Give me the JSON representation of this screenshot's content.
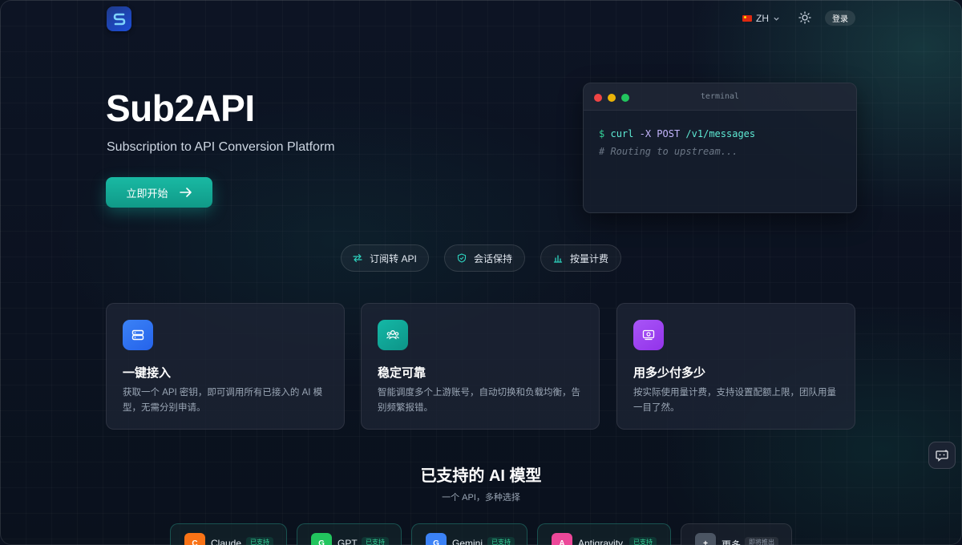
{
  "header": {
    "logo_icon": "sub2api-logo-icon",
    "language": "ZH",
    "theme_icon": "sun-icon",
    "login_label": "登录"
  },
  "hero": {
    "title": "Sub2API",
    "subtitle": "Subscription to API Conversion Platform",
    "cta_label": "立即开始"
  },
  "terminal": {
    "title": "terminal",
    "prompt": "$",
    "command": "curl",
    "flag": "-X POST",
    "path": "/v1/messages",
    "comment": "# Routing to upstream..."
  },
  "pills": [
    {
      "label": "订阅转 API",
      "icon": "swap-arrows-icon"
    },
    {
      "label": "会话保持",
      "icon": "shield-check-icon"
    },
    {
      "label": "按量计费",
      "icon": "bar-chart-icon"
    }
  ],
  "features": [
    {
      "title": "一键接入",
      "desc": "获取一个 API 密钥，即可调用所有已接入的 AI 模型，无需分别申请。",
      "icon": "server-icon",
      "color": "#3b82f6"
    },
    {
      "title": "稳定可靠",
      "desc": "智能调度多个上游账号，自动切换和负载均衡，告别频繁报错。",
      "icon": "users-icon",
      "color": "#14b8a6"
    },
    {
      "title": "用多少付多少",
      "desc": "按实际使用量计费，支持设置配额上限，团队用量一目了然。",
      "icon": "billing-icon",
      "color": "#a855f7"
    }
  ],
  "models_section": {
    "title": "已支持的 AI 模型",
    "subtitle": "一个 API，多种选择"
  },
  "models": [
    {
      "letter": "C",
      "name": "Claude",
      "badge": "已支持",
      "color": "#f97316"
    },
    {
      "letter": "G",
      "name": "GPT",
      "badge": "已支持",
      "color": "#22c55e"
    },
    {
      "letter": "G",
      "name": "Gemini",
      "badge": "已支持",
      "color": "#3b82f6"
    },
    {
      "letter": "A",
      "name": "Antigravity",
      "badge": "已支持",
      "color": "#ec4899"
    },
    {
      "letter": "+",
      "name": "更多",
      "badge": "即将推出",
      "color": "#4b5563"
    }
  ],
  "chat_icon": "chat-bot-icon"
}
